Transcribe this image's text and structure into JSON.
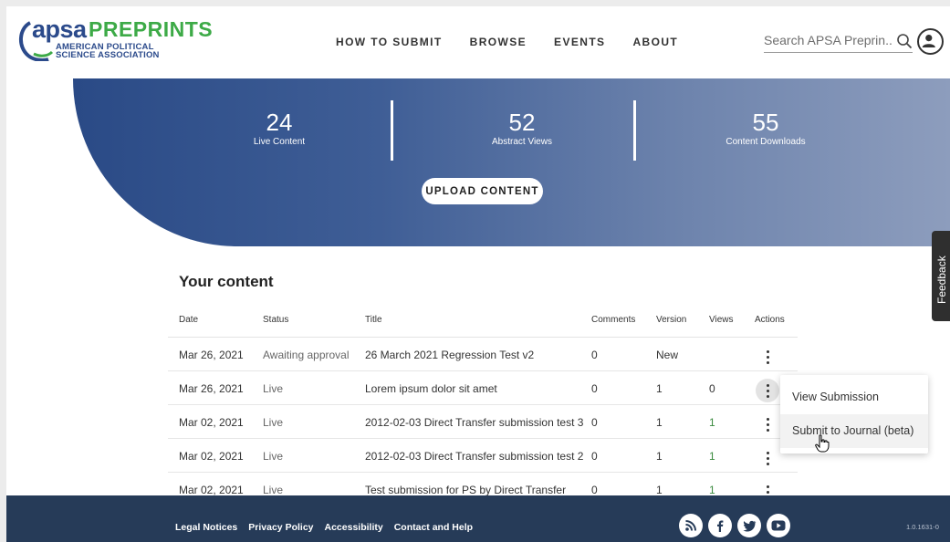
{
  "header": {
    "logo_apsa": "apsa",
    "logo_preprints": "PREPRINTS",
    "logo_line1": "AMERICAN POLITICAL",
    "logo_line2": "SCIENCE ASSOCIATION",
    "nav": [
      "HOW TO SUBMIT",
      "BROWSE",
      "EVENTS",
      "ABOUT"
    ],
    "search_placeholder": "Search APSA Preprin..."
  },
  "hero": {
    "stats": [
      {
        "value": "24",
        "label": "Live Content"
      },
      {
        "value": "52",
        "label": "Abstract Views"
      },
      {
        "value": "55",
        "label": "Content Downloads"
      }
    ],
    "upload_label": "UPLOAD CONTENT"
  },
  "feedback_label": "Feedback",
  "content": {
    "title": "Your content",
    "columns": {
      "date": "Date",
      "status": "Status",
      "title": "Title",
      "comments": "Comments",
      "version": "Version",
      "views": "Views",
      "actions": "Actions"
    },
    "rows": [
      {
        "date": "Mar 26, 2021",
        "status": "Awaiting approval",
        "title": "26 March 2021 Regression Test v2",
        "comments": "0",
        "version": "New",
        "views": ""
      },
      {
        "date": "Mar 26, 2021",
        "status": "Live",
        "title": "Lorem ipsum dolor sit amet",
        "comments": "0",
        "version": "1",
        "views": "0"
      },
      {
        "date": "Mar 02, 2021",
        "status": "Live",
        "title": "2012-02-03 Direct Transfer submission test 3",
        "comments": "0",
        "version": "1",
        "views": "1"
      },
      {
        "date": "Mar 02, 2021",
        "status": "Live",
        "title": "2012-02-03 Direct Transfer submission test 2",
        "comments": "0",
        "version": "1",
        "views": "1"
      },
      {
        "date": "Mar 02, 2021",
        "status": "Live",
        "title": "Test submission for PS by Direct Transfer",
        "comments": "0",
        "version": "1",
        "views": "1"
      }
    ]
  },
  "menu": {
    "items": [
      "View Submission",
      "Submit to Journal (beta)"
    ]
  },
  "footer": {
    "links": [
      "Legal Notices",
      "Privacy Policy",
      "Accessibility",
      "Contact and Help"
    ],
    "social": [
      "rss-icon",
      "facebook-icon",
      "twitter-icon",
      "youtube-icon"
    ],
    "version": "1.0.1631-0"
  },
  "colors": {
    "brand_blue": "#2b4a8b",
    "brand_green": "#3daa47",
    "footer_bg": "#263b58",
    "hero_start": "#2a4a86",
    "hero_end": "#8d9dbd"
  }
}
